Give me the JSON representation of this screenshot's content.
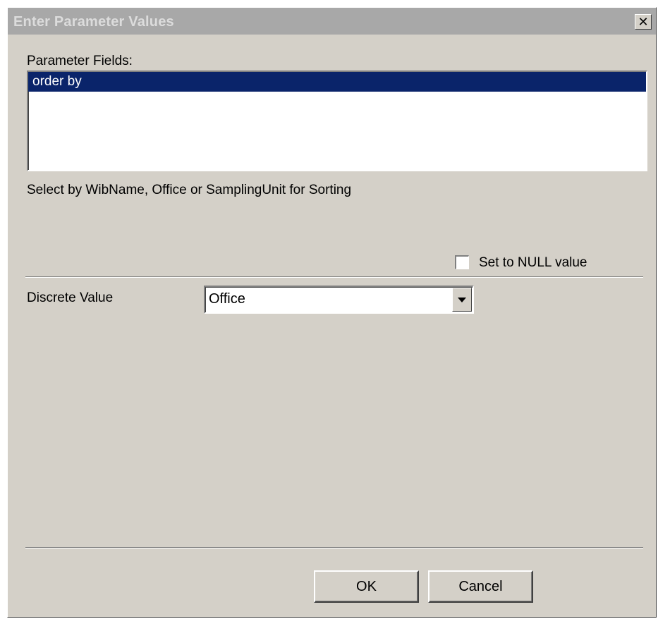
{
  "dialog": {
    "title": "Enter Parameter Values",
    "close_glyph": "✕"
  },
  "parameter_fields": {
    "label": "Parameter Fields:",
    "items": [
      {
        "label": "order by",
        "selected": true
      }
    ]
  },
  "prompt_text": "Select by WibName, Office or SamplingUnit for Sorting",
  "null_option": {
    "label": "Set to NULL value",
    "checked": false
  },
  "discrete_value": {
    "label": "Discrete Value",
    "selected": "Office"
  },
  "buttons": {
    "ok_label": "OK",
    "cancel_label": "Cancel"
  },
  "colors": {
    "selection_bg": "#0a246a",
    "dialog_bg": "#d4d0c8",
    "titlebar_inactive": "#a8a8a8"
  }
}
